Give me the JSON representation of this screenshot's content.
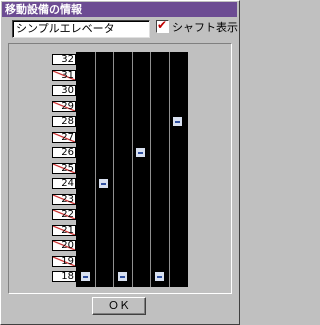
{
  "window": {
    "title": "移動設備の情報"
  },
  "name_field": {
    "value": "シンプルエレベータ"
  },
  "shaft_toggle": {
    "label": "シャフト表示",
    "checked": true
  },
  "floors": [
    {
      "label": "32",
      "enabled": true
    },
    {
      "label": "31",
      "enabled": false
    },
    {
      "label": "30",
      "enabled": true
    },
    {
      "label": "29",
      "enabled": false
    },
    {
      "label": "28",
      "enabled": true
    },
    {
      "label": "27",
      "enabled": false
    },
    {
      "label": "26",
      "enabled": true
    },
    {
      "label": "25",
      "enabled": false
    },
    {
      "label": "24",
      "enabled": true
    },
    {
      "label": "23",
      "enabled": false
    },
    {
      "label": "22",
      "enabled": false
    },
    {
      "label": "21",
      "enabled": false
    },
    {
      "label": "20",
      "enabled": false
    },
    {
      "label": "19",
      "enabled": false
    },
    {
      "label": "18",
      "enabled": true
    }
  ],
  "shafts": 6,
  "cars": [
    {
      "shaft": 0,
      "floor": "18"
    },
    {
      "shaft": 1,
      "floor": "24"
    },
    {
      "shaft": 2,
      "floor": "18"
    },
    {
      "shaft": 3,
      "floor": "26"
    },
    {
      "shaft": 4,
      "floor": "18"
    },
    {
      "shaft": 5,
      "floor": "28"
    }
  ],
  "ok_button": {
    "label": "ＯＫ"
  },
  "colors": {
    "title_bar": "#6c4c93",
    "shaft_bg": "#000000",
    "disabled_mark": "#c00000"
  }
}
